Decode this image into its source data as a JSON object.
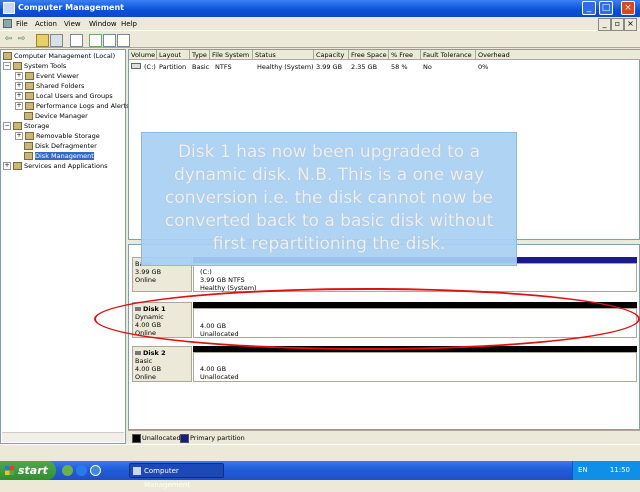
{
  "window": {
    "title": "Computer Management"
  },
  "menu": [
    "File",
    "Action",
    "View",
    "Window",
    "Help"
  ],
  "tree": {
    "root": "Computer Management (Local)",
    "system_tools": "System Tools",
    "event_viewer": "Event Viewer",
    "shared_folders": "Shared Folders",
    "local_users": "Local Users and Groups",
    "perf_logs": "Performance Logs and Alerts",
    "device_manager": "Device Manager",
    "storage": "Storage",
    "removable": "Removable Storage",
    "defrag": "Disk Defragmenter",
    "disk_mgmt": "Disk Management",
    "services": "Services and Applications"
  },
  "volume_list": {
    "headers": [
      "Volume",
      "Layout",
      "Type",
      "File System",
      "Status",
      "Capacity",
      "Free Space",
      "% Free",
      "Fault Tolerance",
      "Overhead"
    ],
    "row": [
      "(C:)",
      "Partition",
      "Basic",
      "NTFS",
      "Healthy (System)",
      "3.99 GB",
      "2.35 GB",
      "58 %",
      "No",
      "0%"
    ]
  },
  "disks": {
    "disk0": {
      "type": "Basic",
      "size": "3.99 GB",
      "status": "Online",
      "vol_name": "(C:)",
      "vol_size": "3.99 GB NTFS",
      "vol_status": "Healthy (System)"
    },
    "disk1": {
      "name": "Disk 1",
      "type": "Dynamic",
      "size": "4.00 GB",
      "status": "Online",
      "vol_size": "4.00 GB",
      "vol_status": "Unallocated"
    },
    "disk2": {
      "name": "Disk 2",
      "type": "Basic",
      "size": "4.00 GB",
      "status": "Online",
      "vol_size": "4.00 GB",
      "vol_status": "Unallocated"
    }
  },
  "legend": {
    "unallocated": "Unallocated",
    "primary": "Primary partition"
  },
  "callout": {
    "text": "Disk 1 has now been upgraded to a dynamic disk. N.B. This is a one way conversion i.e. the disk cannot now be converted back to a basic disk without first repartitioning the disk."
  },
  "taskbar": {
    "start": "start",
    "app": "Computer Management",
    "lang": "EN",
    "clock": "11:50"
  },
  "colors": {
    "titlebar": "#0a50d8",
    "callout": "#a8d0f2",
    "ellipse": "#e01010",
    "unallocated": "#000000",
    "primary": "#1a1a8c"
  }
}
